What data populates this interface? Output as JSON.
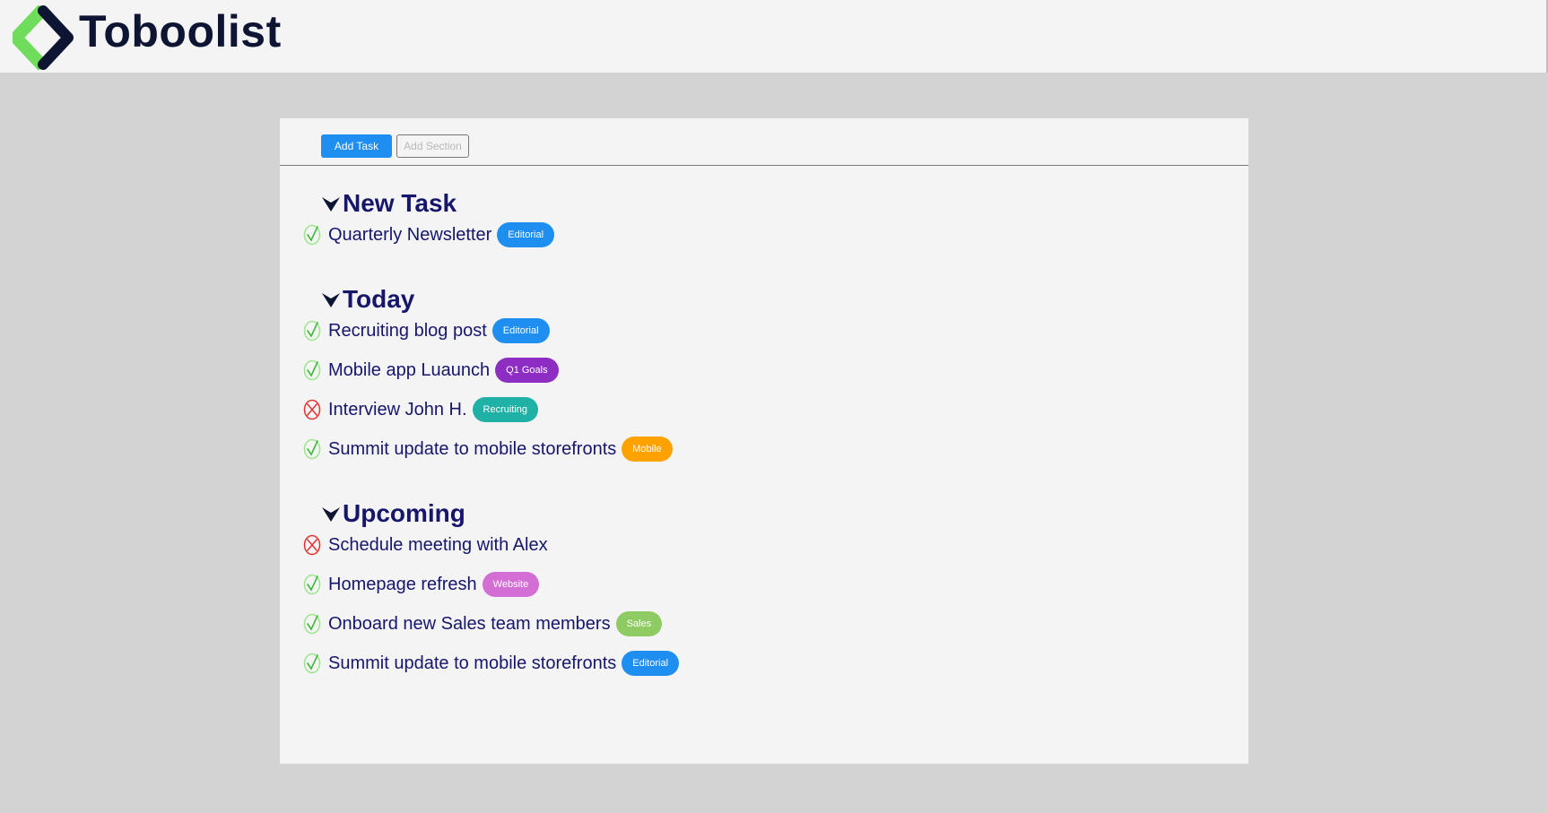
{
  "app": {
    "logo_text": "Toboolist",
    "logo_icon": "diamond-chevron-logo",
    "colors": {
      "logo_green": "#6fdc5b",
      "logo_dark": "#0d1533"
    }
  },
  "toolbar": {
    "add_task_label": "Add Task",
    "add_section_label": "Add Section"
  },
  "sections": [
    {
      "title": "New Task",
      "tasks": [
        {
          "text": "Quarterly Newsletter",
          "status": "done",
          "tag": "Editorial",
          "tag_color": "#1e8ff0"
        }
      ]
    },
    {
      "title": "Today",
      "tasks": [
        {
          "text": "Recruiting blog post",
          "status": "done",
          "tag": "Editorial",
          "tag_color": "#1e8ff0"
        },
        {
          "text": "Mobile app Luaunch",
          "status": "done",
          "tag": "Q1 Goals",
          "tag_color": "#8e2dc2"
        },
        {
          "text": "Interview John H.",
          "status": "failed",
          "tag": "Recruiting",
          "tag_color": "#1fb0a6"
        },
        {
          "text": "Summit update to mobile storefronts",
          "status": "done",
          "tag": "Mobile",
          "tag_color": "#ffa200"
        }
      ]
    },
    {
      "title": "Upcoming",
      "tasks": [
        {
          "text": "Schedule meeting with Alex",
          "status": "failed",
          "tag": "",
          "tag_color": ""
        },
        {
          "text": "Homepage refresh",
          "status": "done",
          "tag": "Website",
          "tag_color": "#d36ed4"
        },
        {
          "text": "Onboard new Sales team members",
          "status": "done",
          "tag": "Sales",
          "tag_color": "#8fcb63"
        },
        {
          "text": "Summit update to mobile storefronts",
          "status": "done",
          "tag": "Editorial",
          "tag_color": "#1e8ff0"
        }
      ]
    }
  ],
  "status_icons": {
    "done": "check-circle-icon",
    "failed": "x-circle-icon"
  }
}
